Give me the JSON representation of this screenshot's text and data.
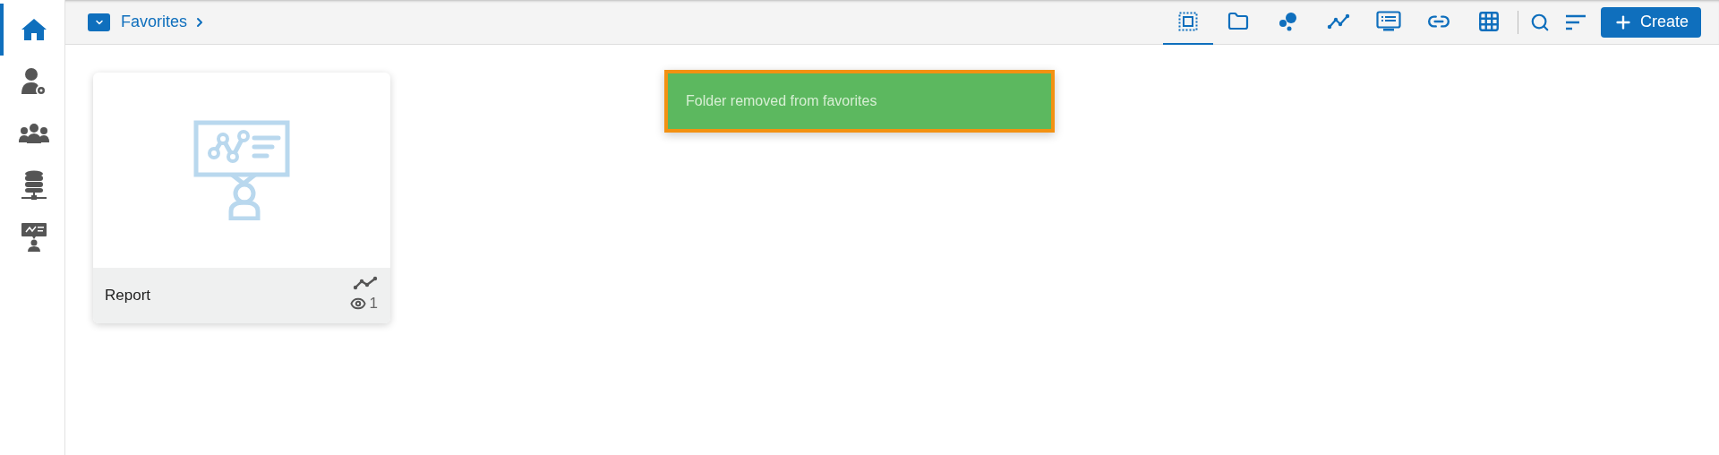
{
  "sidebar": {
    "items": [
      {
        "kind": "home",
        "selected": true
      },
      {
        "kind": "user-admin",
        "selected": false
      },
      {
        "kind": "groups",
        "selected": false
      },
      {
        "kind": "data",
        "selected": false
      },
      {
        "kind": "presenter",
        "selected": false
      }
    ]
  },
  "breadcrumb": {
    "label": "Favorites"
  },
  "toolbar": {
    "filters": [
      {
        "kind": "all",
        "selected": true
      },
      {
        "kind": "folder",
        "selected": false
      },
      {
        "kind": "scatter",
        "selected": false
      },
      {
        "kind": "line",
        "selected": false
      },
      {
        "kind": "dashboard",
        "selected": false
      },
      {
        "kind": "link",
        "selected": false
      },
      {
        "kind": "grid",
        "selected": false
      }
    ],
    "create_button": "Create"
  },
  "toast": {
    "message": "Folder removed from favorites"
  },
  "cards": [
    {
      "title": "Report",
      "views": "1"
    }
  ]
}
